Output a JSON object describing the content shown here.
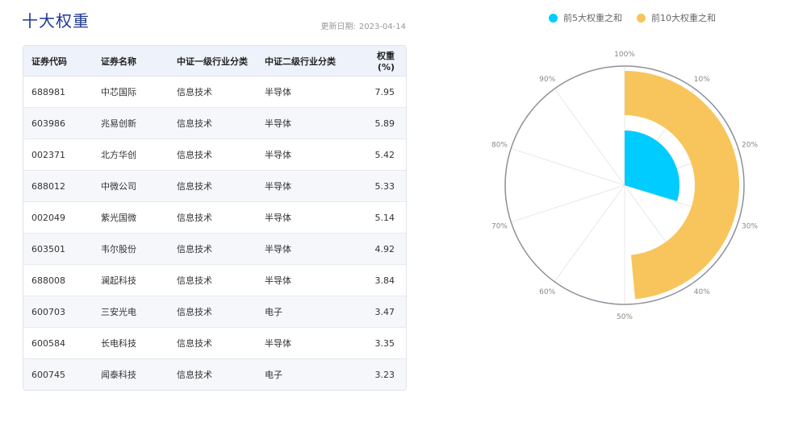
{
  "header": {
    "title": "十大权重",
    "update_label": "更新日期:",
    "update_date": "2023-04-14"
  },
  "table": {
    "headers": [
      "证券代码",
      "证券名称",
      "中证一级行业分类",
      "中证二级行业分类",
      "权重(%)"
    ],
    "rows": [
      [
        "688981",
        "中芯国际",
        "信息技术",
        "半导体",
        "7.95"
      ],
      [
        "603986",
        "兆易创新",
        "信息技术",
        "半导体",
        "5.89"
      ],
      [
        "002371",
        "北方华创",
        "信息技术",
        "半导体",
        "5.42"
      ],
      [
        "688012",
        "中微公司",
        "信息技术",
        "半导体",
        "5.33"
      ],
      [
        "002049",
        "紫光国微",
        "信息技术",
        "半导体",
        "5.14"
      ],
      [
        "603501",
        "韦尔股份",
        "信息技术",
        "半导体",
        "4.92"
      ],
      [
        "688008",
        "澜起科技",
        "信息技术",
        "半导体",
        "3.84"
      ],
      [
        "600703",
        "三安光电",
        "信息技术",
        "电子",
        "3.47"
      ],
      [
        "600584",
        "长电科技",
        "信息技术",
        "半导体",
        "3.35"
      ],
      [
        "600745",
        "闻泰科技",
        "信息技术",
        "电子",
        "3.23"
      ]
    ]
  },
  "chart_data": {
    "type": "bar",
    "coordinate": "polar",
    "angle_axis": {
      "min": 0,
      "max": 100,
      "unit": "%",
      "tick_labels": [
        "100%",
        "10%",
        "20%",
        "30%",
        "40%",
        "50%",
        "60%",
        "70%",
        "80%",
        "90%"
      ]
    },
    "legend_position": "top",
    "series": [
      {
        "name": "前5大权重之和",
        "value": 29.73,
        "color": "#00ccff"
      },
      {
        "name": "前10大权重之和",
        "value": 48.54,
        "color": "#f7c55c"
      }
    ]
  }
}
